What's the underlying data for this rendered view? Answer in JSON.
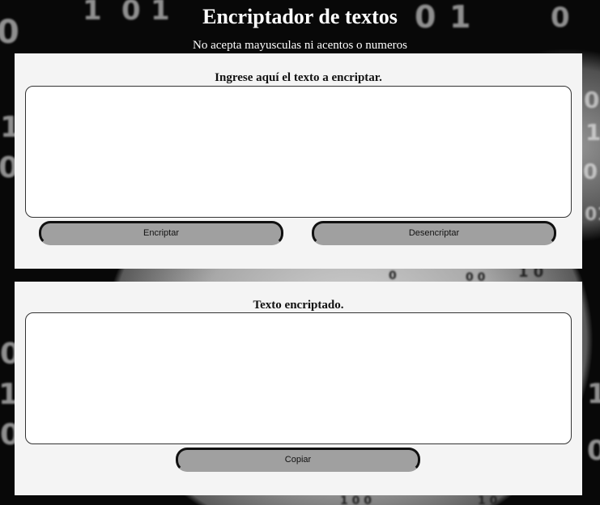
{
  "header": {
    "title": "Encriptador de textos",
    "subtitle": "No acepta mayusculas ni acentos o numeros"
  },
  "encrypt_panel": {
    "label": "Ingrese aquí el texto a encriptar.",
    "input_value": "",
    "encrypt_label": "Encriptar",
    "decrypt_label": "Desencriptar"
  },
  "result_panel": {
    "label": "Texto encriptado.",
    "output_value": "",
    "copy_label": "Copiar"
  },
  "colors": {
    "panel_bg": "#f4f4f4",
    "button_bg": "#a0a0a0",
    "page_bg": "#080808"
  }
}
